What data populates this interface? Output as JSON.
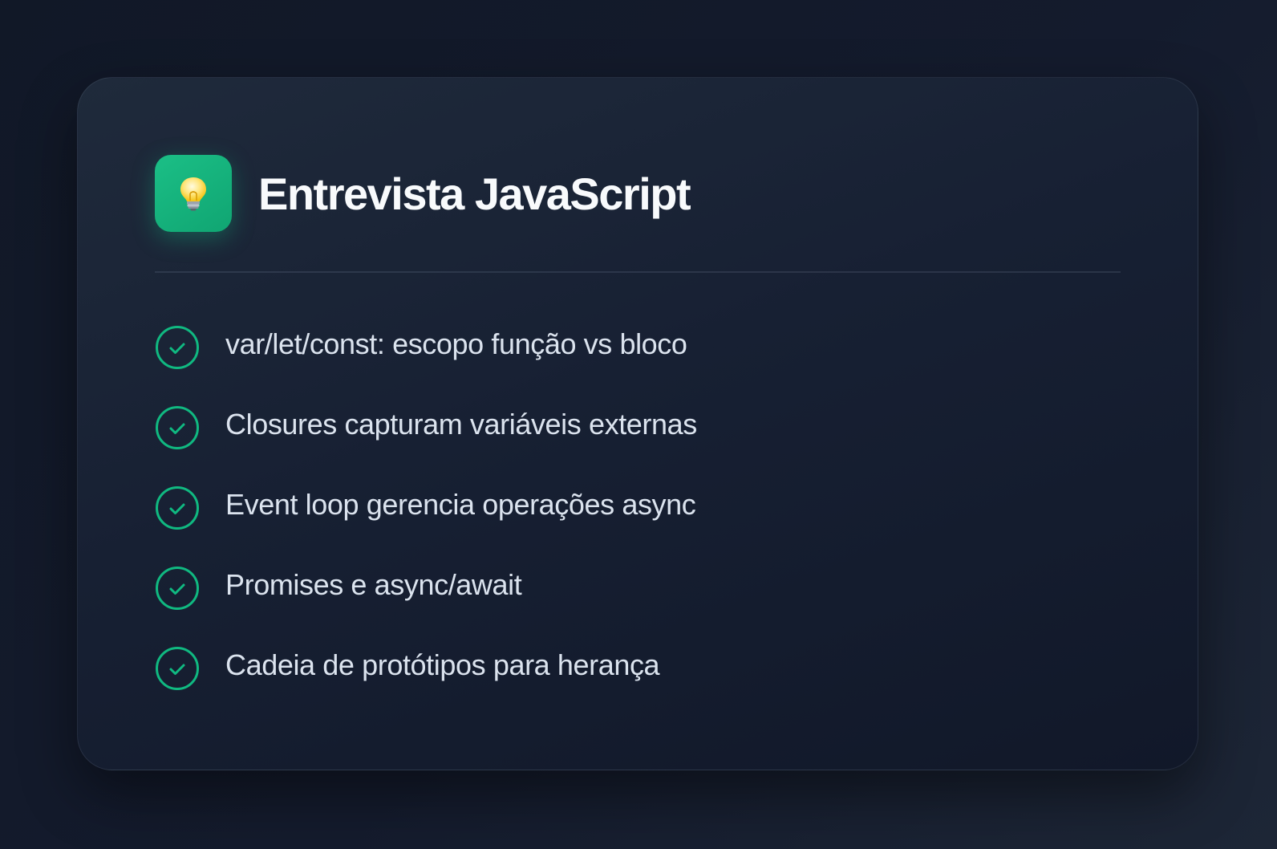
{
  "card": {
    "title": "Entrevista JavaScript",
    "icon": "lightbulb-icon",
    "items": [
      {
        "label": "var/let/const: escopo função vs bloco",
        "icon": "check-circle-icon"
      },
      {
        "label": "Closures capturam variáveis externas",
        "icon": "check-circle-icon"
      },
      {
        "label": "Event loop gerencia operações async",
        "icon": "check-circle-icon"
      },
      {
        "label": "Promises e async/await",
        "icon": "check-circle-icon"
      },
      {
        "label": "Cadeia de protótipos para herança",
        "icon": "check-circle-icon"
      }
    ]
  },
  "colors": {
    "background": "#141b2d",
    "card": "#1a2334",
    "accent": "#10b981",
    "title": "#f8fafc",
    "text": "#dbe3ee"
  }
}
